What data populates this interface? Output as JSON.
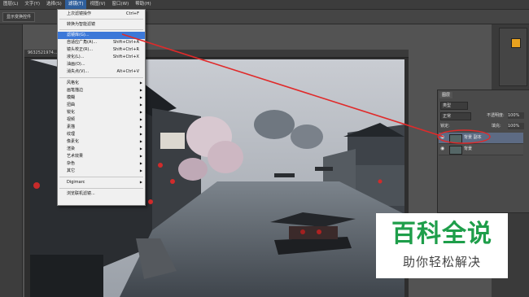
{
  "menubar": {
    "items": [
      "图层(L)",
      "文字(Y)",
      "选择(S)",
      "滤镜(T)",
      "视图(V)",
      "窗口(W)",
      "帮助(H)"
    ],
    "active_index": 3
  },
  "optionsbar": {
    "button_label": "显示变换控件"
  },
  "document": {
    "tab_label": "9632521974... @ ... (RGB/8#) *"
  },
  "filter_menu": {
    "items": [
      {
        "label": "上次滤镜操作",
        "shortcut": "Ctrl+F"
      },
      {
        "label": "转换为智能滤镜",
        "shortcut": ""
      },
      {
        "label": "滤镜库(G)...",
        "shortcut": ""
      },
      {
        "label": "自适应广角(A)...",
        "shortcut": "Shift+Ctrl+A"
      },
      {
        "label": "镜头校正(R)...",
        "shortcut": "Shift+Ctrl+R"
      },
      {
        "label": "液化(L)...",
        "shortcut": "Shift+Ctrl+X"
      },
      {
        "label": "油画(O)...",
        "shortcut": ""
      },
      {
        "label": "消失点(V)...",
        "shortcut": "Alt+Ctrl+V"
      },
      {
        "label": "风格化",
        "shortcut": ""
      },
      {
        "label": "画笔描边",
        "shortcut": ""
      },
      {
        "label": "模糊",
        "shortcut": ""
      },
      {
        "label": "扭曲",
        "shortcut": ""
      },
      {
        "label": "锐化",
        "shortcut": ""
      },
      {
        "label": "视频",
        "shortcut": ""
      },
      {
        "label": "素描",
        "shortcut": ""
      },
      {
        "label": "纹理",
        "shortcut": ""
      },
      {
        "label": "像素化",
        "shortcut": ""
      },
      {
        "label": "渲染",
        "shortcut": ""
      },
      {
        "label": "艺术效果",
        "shortcut": ""
      },
      {
        "label": "杂色",
        "shortcut": ""
      },
      {
        "label": "其它",
        "shortcut": ""
      },
      {
        "label": "Digimarc",
        "shortcut": ""
      },
      {
        "label": "浏览联机滤镜...",
        "shortcut": ""
      }
    ],
    "highlight_index": 2
  },
  "layers_panel": {
    "tab": "图层",
    "kind_label": "类型",
    "blend_mode": "正常",
    "opacity_label": "不透明度:",
    "opacity_value": "100%",
    "lock_label": "锁定:",
    "fill_label": "填充:",
    "fill_value": "100%",
    "layers": [
      {
        "name": "背景 副本",
        "selected": true
      },
      {
        "name": "背景",
        "selected": false
      }
    ]
  },
  "watermark": {
    "title": "百科全说",
    "subtitle": "助你轻松解决"
  },
  "colors": {
    "accent": "#3c78d8",
    "annotation": "#e02a2a",
    "watermark_green": "#1e9e4a"
  }
}
